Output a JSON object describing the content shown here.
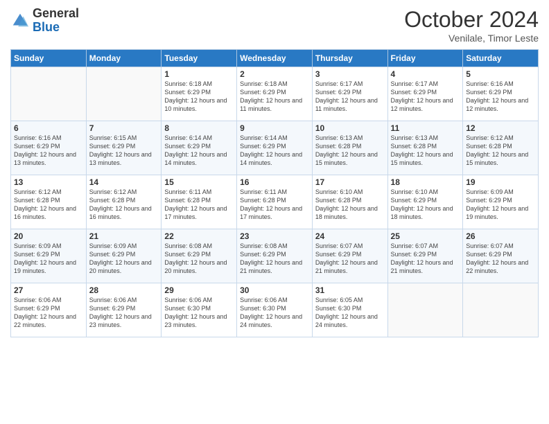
{
  "logo": {
    "general": "General",
    "blue": "Blue"
  },
  "header": {
    "month": "October 2024",
    "location": "Venilale, Timor Leste"
  },
  "weekdays": [
    "Sunday",
    "Monday",
    "Tuesday",
    "Wednesday",
    "Thursday",
    "Friday",
    "Saturday"
  ],
  "weeks": [
    [
      {
        "day": "",
        "sunrise": "",
        "sunset": "",
        "daylight": ""
      },
      {
        "day": "",
        "sunrise": "",
        "sunset": "",
        "daylight": ""
      },
      {
        "day": "1",
        "sunrise": "Sunrise: 6:18 AM",
        "sunset": "Sunset: 6:29 PM",
        "daylight": "Daylight: 12 hours and 10 minutes."
      },
      {
        "day": "2",
        "sunrise": "Sunrise: 6:18 AM",
        "sunset": "Sunset: 6:29 PM",
        "daylight": "Daylight: 12 hours and 11 minutes."
      },
      {
        "day": "3",
        "sunrise": "Sunrise: 6:17 AM",
        "sunset": "Sunset: 6:29 PM",
        "daylight": "Daylight: 12 hours and 11 minutes."
      },
      {
        "day": "4",
        "sunrise": "Sunrise: 6:17 AM",
        "sunset": "Sunset: 6:29 PM",
        "daylight": "Daylight: 12 hours and 12 minutes."
      },
      {
        "day": "5",
        "sunrise": "Sunrise: 6:16 AM",
        "sunset": "Sunset: 6:29 PM",
        "daylight": "Daylight: 12 hours and 12 minutes."
      }
    ],
    [
      {
        "day": "6",
        "sunrise": "Sunrise: 6:16 AM",
        "sunset": "Sunset: 6:29 PM",
        "daylight": "Daylight: 12 hours and 13 minutes."
      },
      {
        "day": "7",
        "sunrise": "Sunrise: 6:15 AM",
        "sunset": "Sunset: 6:29 PM",
        "daylight": "Daylight: 12 hours and 13 minutes."
      },
      {
        "day": "8",
        "sunrise": "Sunrise: 6:14 AM",
        "sunset": "Sunset: 6:29 PM",
        "daylight": "Daylight: 12 hours and 14 minutes."
      },
      {
        "day": "9",
        "sunrise": "Sunrise: 6:14 AM",
        "sunset": "Sunset: 6:29 PM",
        "daylight": "Daylight: 12 hours and 14 minutes."
      },
      {
        "day": "10",
        "sunrise": "Sunrise: 6:13 AM",
        "sunset": "Sunset: 6:28 PM",
        "daylight": "Daylight: 12 hours and 15 minutes."
      },
      {
        "day": "11",
        "sunrise": "Sunrise: 6:13 AM",
        "sunset": "Sunset: 6:28 PM",
        "daylight": "Daylight: 12 hours and 15 minutes."
      },
      {
        "day": "12",
        "sunrise": "Sunrise: 6:12 AM",
        "sunset": "Sunset: 6:28 PM",
        "daylight": "Daylight: 12 hours and 15 minutes."
      }
    ],
    [
      {
        "day": "13",
        "sunrise": "Sunrise: 6:12 AM",
        "sunset": "Sunset: 6:28 PM",
        "daylight": "Daylight: 12 hours and 16 minutes."
      },
      {
        "day": "14",
        "sunrise": "Sunrise: 6:12 AM",
        "sunset": "Sunset: 6:28 PM",
        "daylight": "Daylight: 12 hours and 16 minutes."
      },
      {
        "day": "15",
        "sunrise": "Sunrise: 6:11 AM",
        "sunset": "Sunset: 6:28 PM",
        "daylight": "Daylight: 12 hours and 17 minutes."
      },
      {
        "day": "16",
        "sunrise": "Sunrise: 6:11 AM",
        "sunset": "Sunset: 6:28 PM",
        "daylight": "Daylight: 12 hours and 17 minutes."
      },
      {
        "day": "17",
        "sunrise": "Sunrise: 6:10 AM",
        "sunset": "Sunset: 6:28 PM",
        "daylight": "Daylight: 12 hours and 18 minutes."
      },
      {
        "day": "18",
        "sunrise": "Sunrise: 6:10 AM",
        "sunset": "Sunset: 6:29 PM",
        "daylight": "Daylight: 12 hours and 18 minutes."
      },
      {
        "day": "19",
        "sunrise": "Sunrise: 6:09 AM",
        "sunset": "Sunset: 6:29 PM",
        "daylight": "Daylight: 12 hours and 19 minutes."
      }
    ],
    [
      {
        "day": "20",
        "sunrise": "Sunrise: 6:09 AM",
        "sunset": "Sunset: 6:29 PM",
        "daylight": "Daylight: 12 hours and 19 minutes."
      },
      {
        "day": "21",
        "sunrise": "Sunrise: 6:09 AM",
        "sunset": "Sunset: 6:29 PM",
        "daylight": "Daylight: 12 hours and 20 minutes."
      },
      {
        "day": "22",
        "sunrise": "Sunrise: 6:08 AM",
        "sunset": "Sunset: 6:29 PM",
        "daylight": "Daylight: 12 hours and 20 minutes."
      },
      {
        "day": "23",
        "sunrise": "Sunrise: 6:08 AM",
        "sunset": "Sunset: 6:29 PM",
        "daylight": "Daylight: 12 hours and 21 minutes."
      },
      {
        "day": "24",
        "sunrise": "Sunrise: 6:07 AM",
        "sunset": "Sunset: 6:29 PM",
        "daylight": "Daylight: 12 hours and 21 minutes."
      },
      {
        "day": "25",
        "sunrise": "Sunrise: 6:07 AM",
        "sunset": "Sunset: 6:29 PM",
        "daylight": "Daylight: 12 hours and 21 minutes."
      },
      {
        "day": "26",
        "sunrise": "Sunrise: 6:07 AM",
        "sunset": "Sunset: 6:29 PM",
        "daylight": "Daylight: 12 hours and 22 minutes."
      }
    ],
    [
      {
        "day": "27",
        "sunrise": "Sunrise: 6:06 AM",
        "sunset": "Sunset: 6:29 PM",
        "daylight": "Daylight: 12 hours and 22 minutes."
      },
      {
        "day": "28",
        "sunrise": "Sunrise: 6:06 AM",
        "sunset": "Sunset: 6:29 PM",
        "daylight": "Daylight: 12 hours and 23 minutes."
      },
      {
        "day": "29",
        "sunrise": "Sunrise: 6:06 AM",
        "sunset": "Sunset: 6:30 PM",
        "daylight": "Daylight: 12 hours and 23 minutes."
      },
      {
        "day": "30",
        "sunrise": "Sunrise: 6:06 AM",
        "sunset": "Sunset: 6:30 PM",
        "daylight": "Daylight: 12 hours and 24 minutes."
      },
      {
        "day": "31",
        "sunrise": "Sunrise: 6:05 AM",
        "sunset": "Sunset: 6:30 PM",
        "daylight": "Daylight: 12 hours and 24 minutes."
      },
      {
        "day": "",
        "sunrise": "",
        "sunset": "",
        "daylight": ""
      },
      {
        "day": "",
        "sunrise": "",
        "sunset": "",
        "daylight": ""
      }
    ]
  ]
}
